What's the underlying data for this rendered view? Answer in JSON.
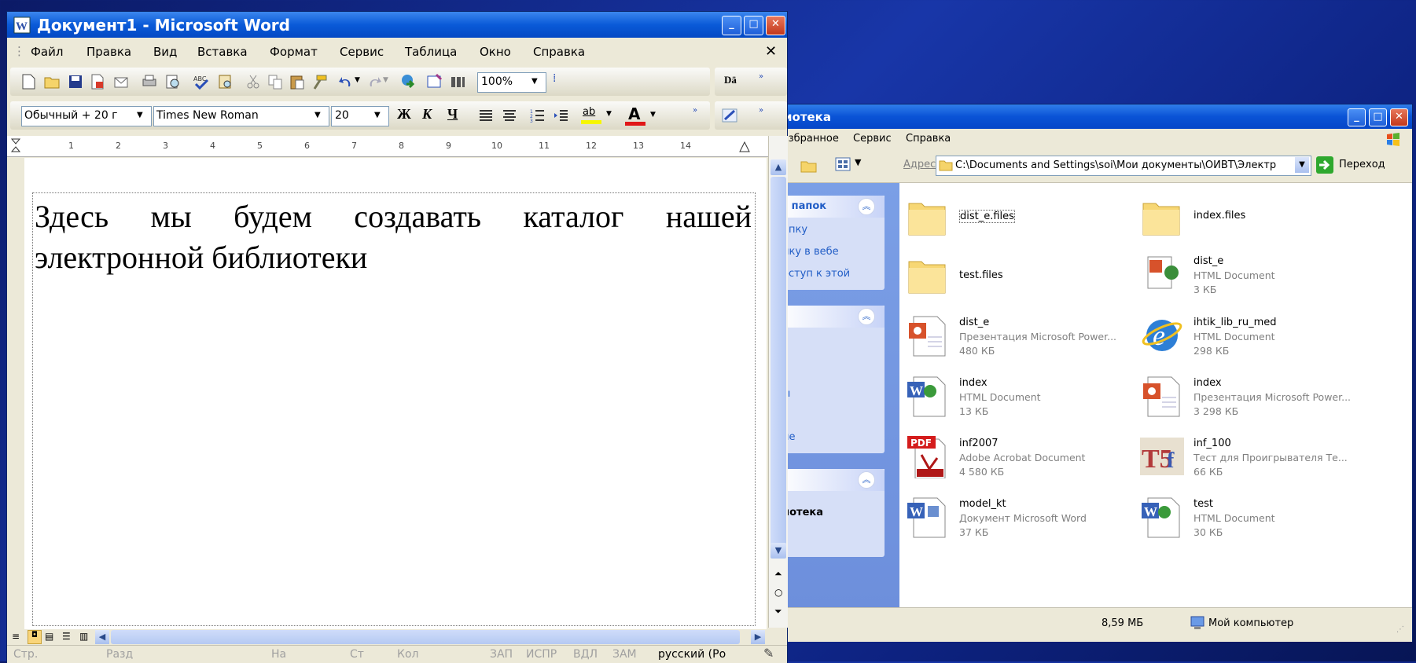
{
  "explorer": {
    "title": "иотека",
    "menu": [
      "Избранное",
      "Сервис",
      "Справка"
    ],
    "address_label": "Адрес:",
    "address_value": "C:\\Documents and Settings\\soi\\Мои документы\\ОИВТ\\Электр",
    "go_label": "Переход",
    "sidebar": {
      "panel1_title": "и папок",
      "panel1_links": [
        "апку",
        "пку в вебе",
        "оступ к этой"
      ],
      "panel2_links": [
        "ы",
        "ие"
      ],
      "panel3_title": "иотека"
    },
    "files": [
      {
        "name": "dist_e.files",
        "type": "",
        "size": "",
        "icon": "folder-icon"
      },
      {
        "name": "index.files",
        "type": "",
        "size": "",
        "icon": "folder-icon"
      },
      {
        "name": "test.files",
        "type": "",
        "size": "",
        "icon": "folder-icon"
      },
      {
        "name": "dist_e",
        "type": "HTML Document",
        "size": "3 КБ",
        "icon": "ppt-html-icon"
      },
      {
        "name": "dist_e",
        "type": "Презентация Microsoft Power...",
        "size": "480 КБ",
        "icon": "powerpoint-icon"
      },
      {
        "name": "ihtik_lib_ru_med",
        "type": "HTML Document",
        "size": "298 КБ",
        "icon": "ie-icon"
      },
      {
        "name": "index",
        "type": "HTML Document",
        "size": "13 КБ",
        "icon": "word-html-icon"
      },
      {
        "name": "index",
        "type": "Презентация Microsoft Power...",
        "size": "3 298 КБ",
        "icon": "powerpoint-icon"
      },
      {
        "name": "inf2007",
        "type": "Adobe Acrobat Document",
        "size": "4 580 КБ",
        "icon": "pdf-icon"
      },
      {
        "name": "inf_100",
        "type": "Тест для Проигрывателя Те...",
        "size": "66 КБ",
        "icon": "test-player-icon"
      },
      {
        "name": "model_kt",
        "type": "Документ Microsoft Word",
        "size": "37 КБ",
        "icon": "word-doc-icon"
      },
      {
        "name": "test",
        "type": "HTML Document",
        "size": "30 КБ",
        "icon": "word-html-icon"
      }
    ],
    "status_size": "8,59 МБ",
    "status_location": "Мой компьютер"
  },
  "word": {
    "title": "Документ1 - Microsoft Word",
    "menu": [
      "Файл",
      "Правка",
      "Вид",
      "Вставка",
      "Формат",
      "Сервис",
      "Таблица",
      "Окно",
      "Справка"
    ],
    "zoom": "100%",
    "style": "Обычный + 20 г",
    "font": "Times New Roman",
    "font_size": "20",
    "bold": "Ж",
    "italic": "К",
    "underline": "Ч",
    "highlight_glyph": "ab",
    "font_color_glyph": "A",
    "ruler_marks": [
      "1",
      "2",
      "3",
      "4",
      "5",
      "6",
      "7",
      "8",
      "9",
      "10",
      "11",
      "12",
      "13",
      "14"
    ],
    "document_text": "Здесь мы будем создавать каталог нашей электронной библиотеки",
    "status": {
      "page": "Стр.",
      "section": "Разд",
      "at": "На",
      "line": "Ст",
      "col": "Кол",
      "rec": "ЗАП",
      "trk": "ИСПР",
      "ext": "ВДЛ",
      "ovr": "ЗАМ",
      "language": "русский (Ро"
    }
  },
  "colors": {
    "title_bar": "#0a5ad8",
    "desktop": "#1836a8",
    "link": "#215dc6"
  }
}
